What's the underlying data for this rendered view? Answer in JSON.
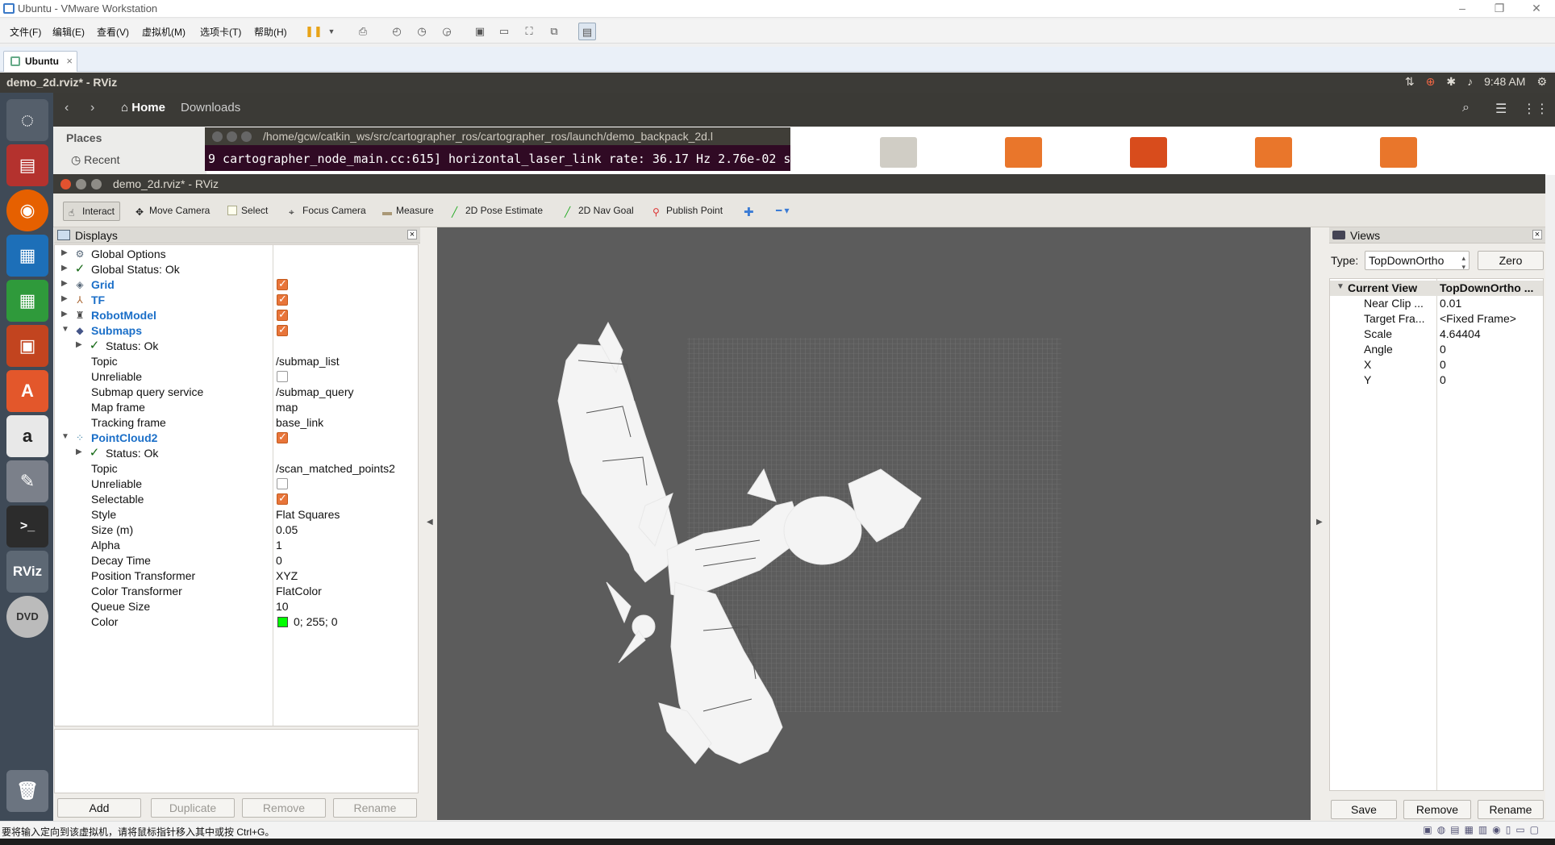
{
  "vmware": {
    "title": "Ubuntu - VMware Workstation",
    "menu": [
      "文件(F)",
      "编辑(E)",
      "查看(V)",
      "虚拟机(M)",
      "选项卡(T)",
      "帮助(H)"
    ],
    "tab_label": "Ubuntu",
    "status_text": "要将输入定向到该虚拟机，请将鼠标指针移入其中或按 Ctrl+G。"
  },
  "ubuntu": {
    "window_title": "demo_2d.rviz* - RViz",
    "clock": "9:48 AM"
  },
  "filemanager": {
    "home_label": "Home",
    "crumb": "Downloads",
    "places_label": "Places",
    "recent_label": "Recent"
  },
  "terminal": {
    "title": "/home/gcw/catkin_ws/src/cartographer_ros/cartographer_ros/launch/demo_backpack_2d.l",
    "line": "9 cartographer_node_main.cc:615] horizontal_laser_link rate: 36.17 Hz 2.76e-02 s"
  },
  "rviz": {
    "title": "demo_2d.rviz* - RViz",
    "tools": {
      "interact": "Interact",
      "move_camera": "Move Camera",
      "select": "Select",
      "focus_camera": "Focus Camera",
      "measure": "Measure",
      "pose_estimate": "2D Pose Estimate",
      "nav_goal": "2D Nav Goal",
      "publish_point": "Publish Point"
    },
    "displays": {
      "header": "Displays",
      "rows": [
        {
          "label": "Global Options",
          "value": ""
        },
        {
          "label": "Global Status: Ok",
          "value": ""
        },
        {
          "label": "Grid",
          "value": ""
        },
        {
          "label": "TF",
          "value": ""
        },
        {
          "label": "RobotModel",
          "value": ""
        },
        {
          "label": "Submaps",
          "value": ""
        },
        {
          "label": "Status: Ok",
          "value": ""
        },
        {
          "label": "Topic",
          "value": "/submap_list"
        },
        {
          "label": "Unreliable",
          "value": ""
        },
        {
          "label": "Submap query service",
          "value": "/submap_query"
        },
        {
          "label": "Map frame",
          "value": "map"
        },
        {
          "label": "Tracking frame",
          "value": "base_link"
        },
        {
          "label": "PointCloud2",
          "value": ""
        },
        {
          "label": "Status: Ok",
          "value": ""
        },
        {
          "label": "Topic",
          "value": "/scan_matched_points2"
        },
        {
          "label": "Unreliable",
          "value": ""
        },
        {
          "label": "Selectable",
          "value": ""
        },
        {
          "label": "Style",
          "value": "Flat Squares"
        },
        {
          "label": "Size (m)",
          "value": "0.05"
        },
        {
          "label": "Alpha",
          "value": "1"
        },
        {
          "label": "Decay Time",
          "value": "0"
        },
        {
          "label": "Position Transformer",
          "value": "XYZ"
        },
        {
          "label": "Color Transformer",
          "value": "FlatColor"
        },
        {
          "label": "Queue Size",
          "value": "10"
        },
        {
          "label": "Color",
          "value": "0; 255; 0"
        }
      ],
      "buttons": {
        "add": "Add",
        "duplicate": "Duplicate",
        "remove": "Remove",
        "rename": "Rename"
      }
    },
    "views": {
      "header": "Views",
      "type_label": "Type:",
      "type_value": "TopDownOrtho",
      "zero": "Zero",
      "current_view": "Current View",
      "current_view_value": "TopDownOrtho ...",
      "rows": [
        {
          "label": "Near Clip ...",
          "value": "0.01"
        },
        {
          "label": "Target Fra...",
          "value": "<Fixed Frame>"
        },
        {
          "label": "Scale",
          "value": "4.64404"
        },
        {
          "label": "Angle",
          "value": "0"
        },
        {
          "label": "X",
          "value": "0"
        },
        {
          "label": "Y",
          "value": "0"
        }
      ],
      "buttons": {
        "save": "Save",
        "remove": "Remove",
        "rename": "Rename"
      }
    },
    "colors": {
      "accent": "#e8753a",
      "viewport": "#5c5c5c",
      "point_color": "#00ff00"
    }
  }
}
